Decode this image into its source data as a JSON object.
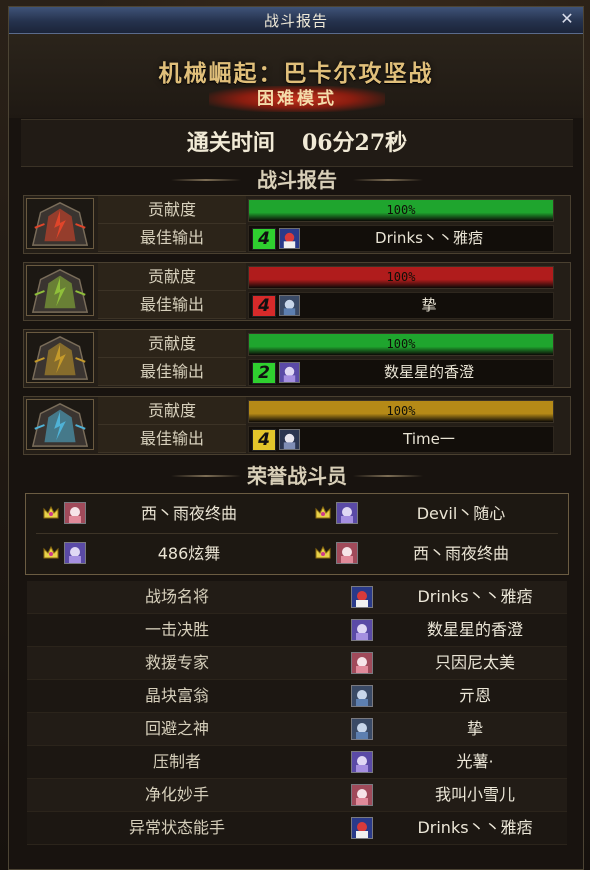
{
  "window": {
    "title": "战斗报告",
    "close_glyph": "✕"
  },
  "hero": {
    "dungeon_name": "机械崛起：巴卡尔攻坚战",
    "difficulty": "困难模式"
  },
  "clear": {
    "label": "通关时间",
    "time": "06分27秒"
  },
  "report": {
    "title": "战斗报告",
    "contribution_label": "贡献度",
    "best_output_label": "最佳输出",
    "bosses": [
      {
        "portrait_icon": "red-boss-portrait-icon",
        "accent": "#e0452a",
        "bar_color": "#1fa52e",
        "contribution": "100%",
        "party_no": "4",
        "badge_color": "#2fd02f",
        "char_icon": "priest-avatar-icon",
        "best_player": "Drinks丶丶雅痞"
      },
      {
        "portrait_icon": "green-boss-portrait-icon",
        "accent": "#8fbf3a",
        "bar_color": "#b01c1c",
        "contribution": "100%",
        "party_no": "4",
        "badge_color": "#d62a2a",
        "char_icon": "gunner-avatar-icon",
        "best_player": "挚"
      },
      {
        "portrait_icon": "gold-boss-portrait-icon",
        "accent": "#c59a2a",
        "bar_color": "#1fa52e",
        "contribution": "100%",
        "party_no": "2",
        "badge_color": "#2fd02f",
        "char_icon": "mage-avatar-icon",
        "best_player": "数星星的香澄"
      },
      {
        "portrait_icon": "blue-boss-portrait-icon",
        "accent": "#4fb2d6",
        "bar_color": "#b58a17",
        "contribution": "100%",
        "party_no": "4",
        "badge_color": "#e2c52a",
        "char_icon": "swordsman-avatar-icon",
        "best_player": "Time一"
      }
    ]
  },
  "honor": {
    "title": "荣誉战斗员",
    "members": [
      {
        "crown_icon": "crown-icon",
        "icon": "fighter-avatar-icon",
        "name": "西丶雨夜终曲"
      },
      {
        "crown_icon": "crown-icon",
        "icon": "mage-avatar-icon",
        "name": "Devil丶随心"
      },
      {
        "crown_icon": "crown-icon",
        "icon": "mage-avatar-icon",
        "name": "486炫舞"
      },
      {
        "crown_icon": "crown-icon",
        "icon": "fighter-avatar-icon",
        "name": "西丶雨夜终曲"
      }
    ]
  },
  "titles": [
    {
      "label": "战场名将",
      "icon": "priest-avatar-icon",
      "name": "Drinks丶丶雅痞"
    },
    {
      "label": "一击决胜",
      "icon": "mage-avatar-icon",
      "name": "数星星的香澄"
    },
    {
      "label": "救援专家",
      "icon": "fighter-avatar-icon",
      "name": "只因尼太美"
    },
    {
      "label": "晶块富翁",
      "icon": "gunner-avatar-icon",
      "name": "亓恩"
    },
    {
      "label": "回避之神",
      "icon": "gunner-avatar-icon",
      "name": "挚"
    },
    {
      "label": "压制者",
      "icon": "mage-avatar-icon",
      "name": "光薯·"
    },
    {
      "label": "净化妙手",
      "icon": "fighter-avatar-icon",
      "name": "我叫小雪儿"
    },
    {
      "label": "异常状态能手",
      "icon": "priest-avatar-icon",
      "name": "Drinks丶丶雅痞"
    }
  ]
}
